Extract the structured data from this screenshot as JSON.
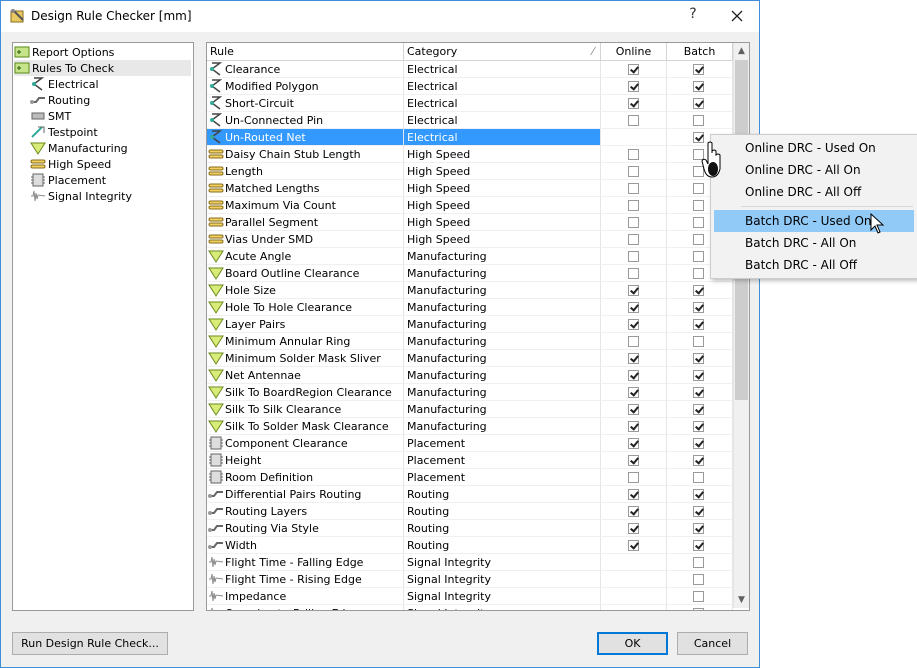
{
  "window": {
    "title": "Design Rule Checker [mm]",
    "help": "?"
  },
  "tree": {
    "items": [
      {
        "label": "Report Options",
        "icon": "report-options-icon",
        "selected": false
      },
      {
        "label": "Rules To Check",
        "icon": "rules-to-check-icon",
        "selected": true
      },
      {
        "label": "Electrical",
        "icon": "electrical-icon",
        "selected": false
      },
      {
        "label": "Routing",
        "icon": "routing-icon",
        "selected": false
      },
      {
        "label": "SMT",
        "icon": "smt-icon",
        "selected": false
      },
      {
        "label": "Testpoint",
        "icon": "testpoint-icon",
        "selected": false
      },
      {
        "label": "Manufacturing",
        "icon": "manufacturing-icon",
        "selected": false
      },
      {
        "label": "High Speed",
        "icon": "high-speed-icon",
        "selected": false
      },
      {
        "label": "Placement",
        "icon": "placement-icon",
        "selected": false
      },
      {
        "label": "Signal Integrity",
        "icon": "signal-integrity-icon",
        "selected": false
      }
    ]
  },
  "grid": {
    "headers": {
      "rule": "Rule",
      "category": "Category",
      "online": "Online",
      "batch": "Batch"
    },
    "rows": [
      {
        "rule": "Clearance",
        "category": "Electrical",
        "online": true,
        "batch": true
      },
      {
        "rule": "Modified Polygon",
        "category": "Electrical",
        "online": true,
        "batch": true
      },
      {
        "rule": "Short-Circuit",
        "category": "Electrical",
        "online": true,
        "batch": true
      },
      {
        "rule": "Un-Connected Pin",
        "category": "Electrical",
        "online": false,
        "batch": false
      },
      {
        "rule": "Un-Routed Net",
        "category": "Electrical",
        "online": null,
        "batch": true,
        "selected": true
      },
      {
        "rule": "Daisy Chain Stub Length",
        "category": "High Speed",
        "online": false,
        "batch": false
      },
      {
        "rule": "Length",
        "category": "High Speed",
        "online": false,
        "batch": false
      },
      {
        "rule": "Matched Lengths",
        "category": "High Speed",
        "online": false,
        "batch": false
      },
      {
        "rule": "Maximum Via Count",
        "category": "High Speed",
        "online": false,
        "batch": false
      },
      {
        "rule": "Parallel Segment",
        "category": "High Speed",
        "online": false,
        "batch": false
      },
      {
        "rule": "Vias Under SMD",
        "category": "High Speed",
        "online": false,
        "batch": false
      },
      {
        "rule": "Acute Angle",
        "category": "Manufacturing",
        "online": false,
        "batch": false
      },
      {
        "rule": "Board Outline Clearance",
        "category": "Manufacturing",
        "online": false,
        "batch": false
      },
      {
        "rule": "Hole Size",
        "category": "Manufacturing",
        "online": true,
        "batch": true
      },
      {
        "rule": "Hole To Hole Clearance",
        "category": "Manufacturing",
        "online": true,
        "batch": true
      },
      {
        "rule": "Layer Pairs",
        "category": "Manufacturing",
        "online": true,
        "batch": true
      },
      {
        "rule": "Minimum Annular Ring",
        "category": "Manufacturing",
        "online": false,
        "batch": false
      },
      {
        "rule": "Minimum Solder Mask Sliver",
        "category": "Manufacturing",
        "online": true,
        "batch": true
      },
      {
        "rule": "Net Antennae",
        "category": "Manufacturing",
        "online": true,
        "batch": true
      },
      {
        "rule": "Silk To BoardRegion Clearance",
        "category": "Manufacturing",
        "online": true,
        "batch": true
      },
      {
        "rule": "Silk To Silk Clearance",
        "category": "Manufacturing",
        "online": true,
        "batch": true
      },
      {
        "rule": "Silk To Solder Mask Clearance",
        "category": "Manufacturing",
        "online": true,
        "batch": true
      },
      {
        "rule": "Component Clearance",
        "category": "Placement",
        "online": true,
        "batch": true
      },
      {
        "rule": "Height",
        "category": "Placement",
        "online": true,
        "batch": true
      },
      {
        "rule": "Room Definition",
        "category": "Placement",
        "online": false,
        "batch": false
      },
      {
        "rule": "Differential Pairs Routing",
        "category": "Routing",
        "online": true,
        "batch": true
      },
      {
        "rule": "Routing Layers",
        "category": "Routing",
        "online": true,
        "batch": true
      },
      {
        "rule": "Routing Via Style",
        "category": "Routing",
        "online": true,
        "batch": true
      },
      {
        "rule": "Width",
        "category": "Routing",
        "online": true,
        "batch": true
      },
      {
        "rule": "Flight Time - Falling Edge",
        "category": "Signal Integrity",
        "online": null,
        "batch": false
      },
      {
        "rule": "Flight Time - Rising Edge",
        "category": "Signal Integrity",
        "online": null,
        "batch": false
      },
      {
        "rule": "Impedance",
        "category": "Signal Integrity",
        "online": null,
        "batch": false
      },
      {
        "rule": "Overshoot - Falling Edge",
        "category": "Signal Integrity",
        "online": null,
        "batch": false
      }
    ]
  },
  "context_menu": {
    "items": [
      "Online DRC - Used On",
      "Online DRC - All On",
      "Online DRC - All Off",
      "Batch DRC - Used On",
      "Batch DRC - All On",
      "Batch DRC - All Off"
    ],
    "highlighted": "Batch DRC - Used On"
  },
  "buttons": {
    "run": "Run Design Rule Check...",
    "ok": "OK",
    "cancel": "Cancel"
  },
  "colors": {
    "selection": "#3399ff",
    "menu_highlight": "#91c9f7",
    "window_border": "#3c8fd8"
  }
}
